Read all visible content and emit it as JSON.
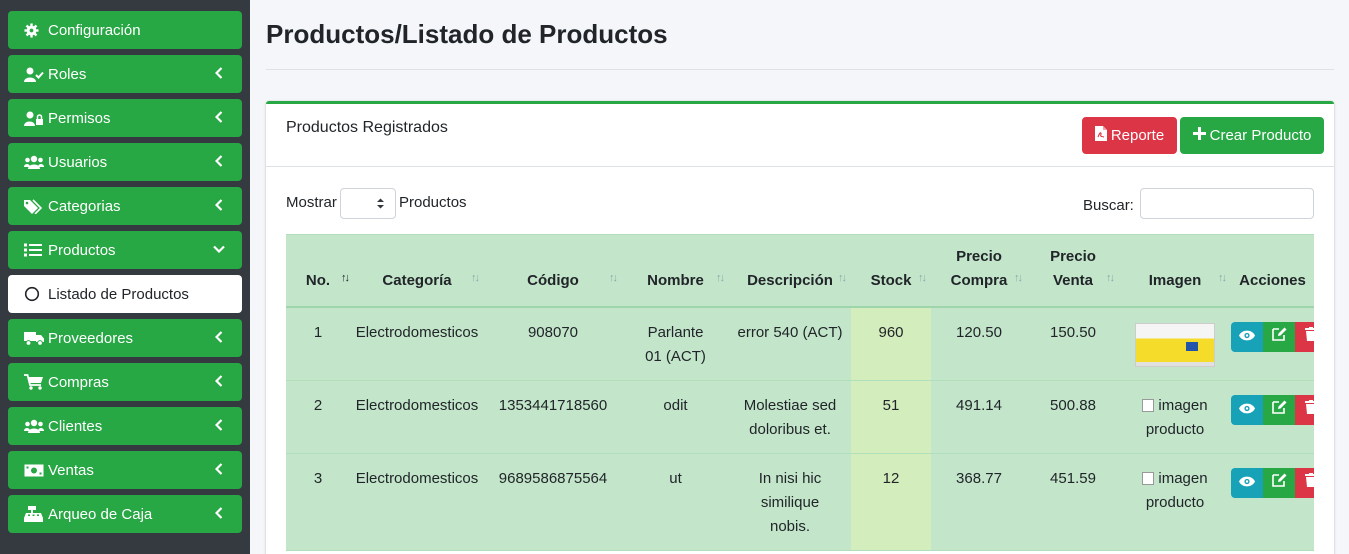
{
  "sidebar": {
    "items": [
      {
        "label": "Configuración",
        "icon": "gear-icon",
        "chevron": ""
      },
      {
        "label": "Roles",
        "icon": "user-check-icon",
        "chevron": "left"
      },
      {
        "label": "Permisos",
        "icon": "user-lock-icon",
        "chevron": "left"
      },
      {
        "label": "Usuarios",
        "icon": "users-icon",
        "chevron": "left"
      },
      {
        "label": "Categorias",
        "icon": "tags-icon",
        "chevron": "left"
      },
      {
        "label": "Productos",
        "icon": "list-icon",
        "chevron": "down"
      },
      {
        "label": "Listado de Productos",
        "icon": "circle-icon",
        "chevron": ""
      },
      {
        "label": "Proveedores",
        "icon": "truck-icon",
        "chevron": "left"
      },
      {
        "label": "Compras",
        "icon": "cart-icon",
        "chevron": "left"
      },
      {
        "label": "Clientes",
        "icon": "users-icon",
        "chevron": "left"
      },
      {
        "label": "Ventas",
        "icon": "money-icon",
        "chevron": "left"
      },
      {
        "label": "Arqueo de Caja",
        "icon": "cash-register-icon",
        "chevron": "left"
      }
    ]
  },
  "page": {
    "title": "Productos/Listado de Productos"
  },
  "card": {
    "title": "Productos Registrados",
    "report_label": "Reporte",
    "create_label": "Crear Producto"
  },
  "controls": {
    "show_label": "Mostrar",
    "show_value": "",
    "show_suffix": "Productos",
    "search_label": "Buscar:",
    "search_value": ""
  },
  "table": {
    "headers": [
      "No.",
      "Categoría",
      "Código",
      "Nombre",
      "Descripción",
      "Stock",
      "Precio Compra",
      "Precio Venta",
      "Imagen",
      "Acciones"
    ],
    "rows": [
      {
        "no": "1",
        "categoria": "Electrodomesticos",
        "codigo": "908070",
        "nombre": "Parlante 01 (ACT)",
        "descripcion": "error 540 (ACT)",
        "stock": "960",
        "precio_compra": "120.50",
        "precio_venta": "150.50",
        "imagen": "thumbnail"
      },
      {
        "no": "2",
        "categoria": "Electrodomesticos",
        "codigo": "1353441718560",
        "nombre": "odit",
        "descripcion": "Molestiae sed doloribus et.",
        "stock": "51",
        "precio_compra": "491.14",
        "precio_venta": "500.88",
        "imagen": "imagen producto"
      },
      {
        "no": "3",
        "categoria": "Electrodomesticos",
        "codigo": "9689586875564",
        "nombre": "ut",
        "descripcion": "In nisi hic similique nobis.",
        "stock": "12",
        "precio_compra": "368.77",
        "precio_venta": "451.59",
        "imagen": "imagen producto"
      }
    ]
  },
  "colors": {
    "accent": "#28a745",
    "danger": "#dc3545",
    "info": "#17a2b8",
    "sidebar_bg": "#343a40",
    "table_bg": "#c3e6cb"
  }
}
